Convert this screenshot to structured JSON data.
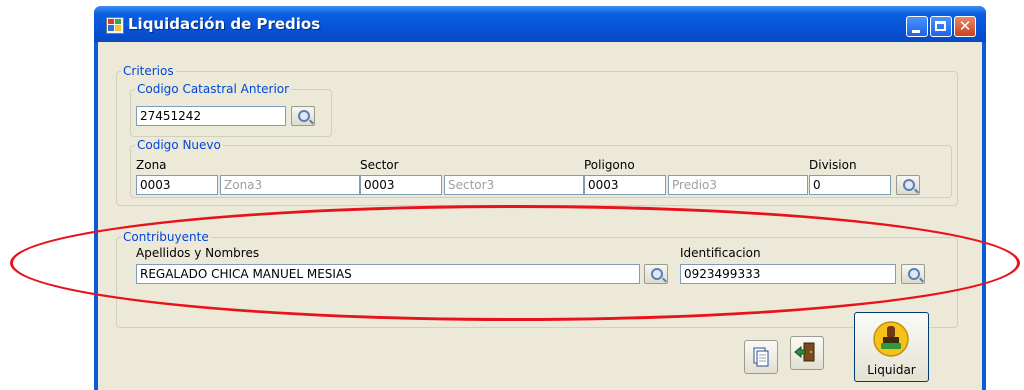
{
  "window": {
    "title": "Liquidación de Predios"
  },
  "criterios": {
    "legend": "Criterios",
    "codigo_anterior": {
      "legend": "Codigo Catastral Anterior",
      "value": "27451242"
    },
    "codigo_nuevo": {
      "legend": "Codigo Nuevo",
      "zona_label": "Zona",
      "zona_value": "0003",
      "zona_name": "Zona3",
      "sector_label": "Sector",
      "sector_value": "0003",
      "sector_name": "Sector3",
      "poligono_label": "Poligono",
      "poligono_value": "0003",
      "predio_name": "Predio3",
      "division_label": "Division",
      "division_value": "0"
    }
  },
  "contribuyente": {
    "legend": "Contribuyente",
    "nombres_label": "Apellidos y Nombres",
    "nombres_value": "REGALADO CHICA MANUEL MESIAS",
    "identificacion_label": "Identificacion",
    "identificacion_value": "0923499333"
  },
  "actions": {
    "liquidar_label": "Liquidar"
  },
  "icons": {
    "search": "magnifier-icon",
    "new": "document-icon",
    "exit": "exit-door-icon",
    "liquidar": "stamp-icon"
  },
  "colors": {
    "titlebar": "#0653d8",
    "legend": "#0046d5",
    "highlight": "#e8121b"
  }
}
